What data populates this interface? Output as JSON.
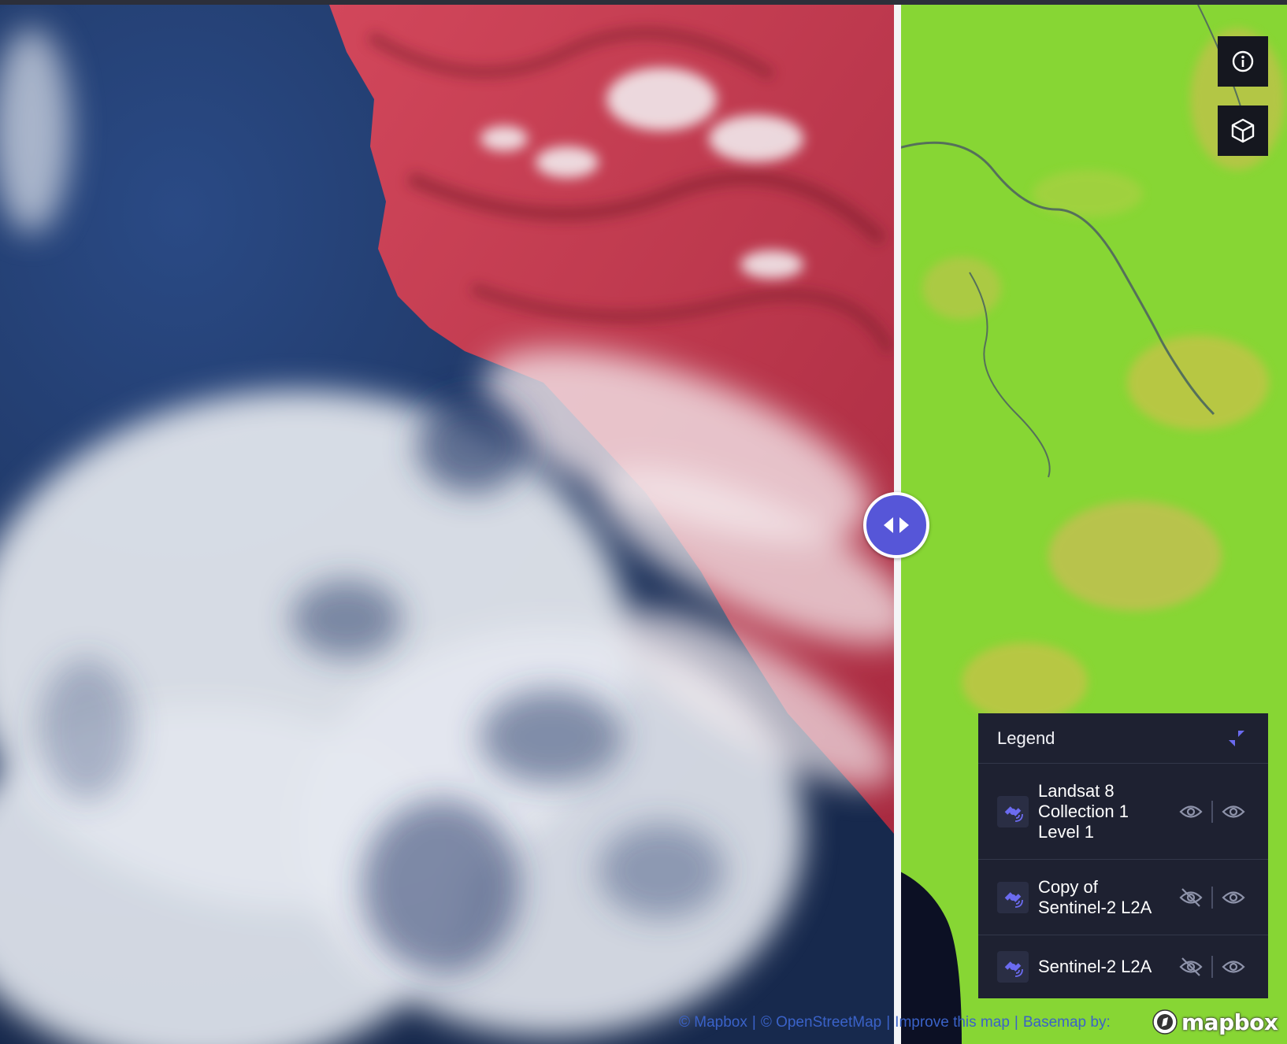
{
  "map": {
    "left_layer": "Landsat 8 Collection 1 Level 1",
    "right_layer": "Sentinel-2 L2A",
    "compare_handle_icon": "arrow-left-right-icon",
    "colors": {
      "ocean": "#1d3560",
      "infrared_land": "#c8364c",
      "cloud": "#e8ecf2",
      "vegetation": "#88d636",
      "accent": "#5656d8"
    }
  },
  "controls": {
    "info_icon": "info-icon",
    "view_3d_icon": "cube-icon"
  },
  "legend": {
    "title": "Legend",
    "collapse_icon": "collapse-icon",
    "layers": [
      {
        "name": "Landsat 8\nCollection 1\nLevel 1",
        "icon": "satellite-icon",
        "visible": true,
        "compare_visible": true
      },
      {
        "name": "Copy of\nSentinel-2 L2A",
        "icon": "satellite-icon",
        "visible": false,
        "compare_visible": true
      },
      {
        "name": "Sentinel-2 L2A",
        "icon": "satellite-icon",
        "visible": false,
        "compare_visible": true
      }
    ]
  },
  "attribution": {
    "mapbox": "© Mapbox",
    "osm": "© OpenStreetMap",
    "improve": "Improve this map",
    "basemap": "Basemap by:",
    "logo_text": "mapbox"
  }
}
